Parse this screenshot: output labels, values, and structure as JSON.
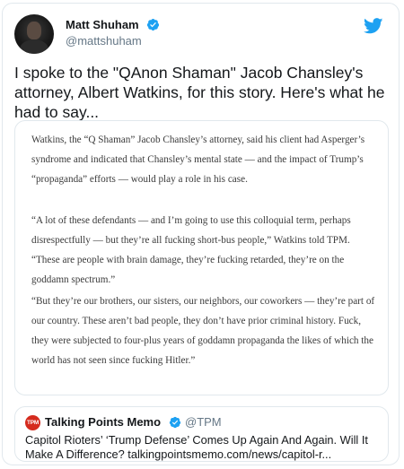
{
  "author": {
    "display_name": "Matt Shuham",
    "handle": "@mattshuham",
    "verified": true,
    "avatar_icon": "user-avatar"
  },
  "platform_icon": "twitter-bird-icon",
  "colors": {
    "twitter_blue": "#1da1f2",
    "tpm_red": "#d52b1e",
    "handle_gray": "#657786",
    "border": "#e1e8ed"
  },
  "tweet_text": "I spoke to the \"QAnon Shaman\" Jacob Chansley's attorney, Albert Watkins, for this story. Here's what he had to say...",
  "article": {
    "paragraphs": [
      "Watkins, the “Q Shaman” Jacob Chansley’s attorney, said his client had Asperger’s syndrome and indicated that Chansley’s mental state — and the impact of Trump’s “propaganda” efforts — would play a role in his case.",
      "“A lot of these defendants — and I’m going to use this colloquial term, perhaps disrespectfully — but they’re all fucking short-bus people,” Watkins told TPM. “These are people with brain damage, they’re fucking retarded, they’re on the goddamn spectrum.”",
      "“But they’re our brothers, our sisters, our neighbors, our coworkers — they’re part of our country. These aren’t bad people, they don’t have prior criminal history. Fuck, they were subjected to four-plus years of goddamn propaganda the likes of which the world has not seen since fucking Hitler.”"
    ]
  },
  "quoted_tweet": {
    "logo_text": "TPM",
    "display_name": "Talking Points Memo",
    "handle": "@TPM",
    "verified": true,
    "text": "Capitol Rioters’ ‘Trump Defense’ Comes Up Again And Again. Will It Make A Difference? talkingpointsmemo.com/news/capitol-r..."
  }
}
